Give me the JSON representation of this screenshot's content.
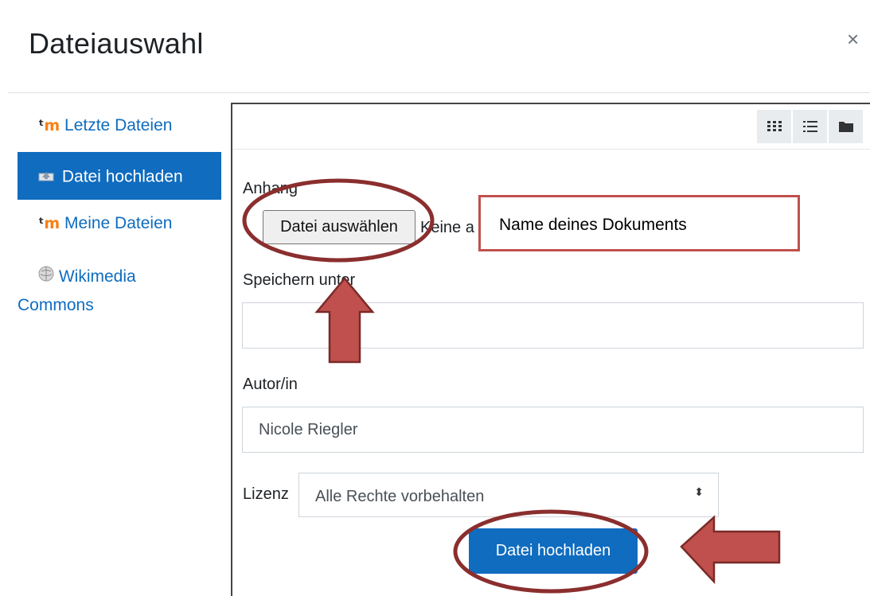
{
  "dialog": {
    "title": "Dateiauswahl",
    "close_glyph": "×"
  },
  "sidebar": {
    "items": [
      {
        "label": "Letzte Dateien",
        "icon": "moodle-icon",
        "active": false
      },
      {
        "label": "Datei hochladen",
        "icon": "upload-icon",
        "active": true
      },
      {
        "label": "Meine Dateien",
        "icon": "moodle-icon",
        "active": false
      },
      {
        "label_line1": "Wikimedia",
        "label_line2": "Commons",
        "icon": "wikipedia-icon",
        "active": false
      }
    ]
  },
  "toolbar": {
    "views": [
      "grid-view-icon",
      "list-view-icon",
      "folder-view-icon"
    ]
  },
  "form": {
    "attachment_label": "Anhang",
    "choose_file_label": "Datei auswählen",
    "file_status": "Keine a",
    "save_as_label": "Speichern unter",
    "save_as_value": "",
    "author_label": "Autor/in",
    "author_value": "Nicole Riegler",
    "license_label": "Lizenz",
    "license_value": "Alle Rechte vorbehalten",
    "submit_label": "Datei hochladen"
  },
  "annotation": {
    "callout_text": "Name deines Dokuments",
    "highlight_color": "#8b2e2e",
    "arrow_color": "#c0504d"
  },
  "colors": {
    "accent": "#0f6cbf",
    "moodle_orange": "#f98012"
  }
}
